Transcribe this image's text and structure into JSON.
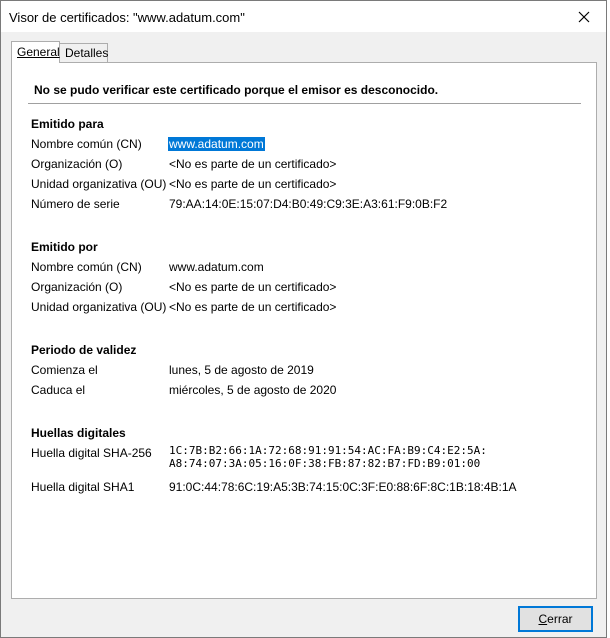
{
  "window": {
    "title": "Visor de certificados: \"www.adatum.com\"",
    "close_icon": "close-icon"
  },
  "tabs": [
    {
      "label": "General",
      "active": true
    },
    {
      "label": "Detalles",
      "active": false
    }
  ],
  "warning": "No se pudo verificar este certificado porque el emisor es desconocido.",
  "issued_to": {
    "title": "Emitido para",
    "rows": [
      {
        "label": "Nombre común (CN)",
        "value": "www.adatum.com"
      },
      {
        "label": "Organización (O)",
        "value": "<No es parte de un certificado>"
      },
      {
        "label": "Unidad organizativa (OU)",
        "value": "<No es parte de un certificado>"
      },
      {
        "label": "Número de serie",
        "value": "79:AA:14:0E:15:07:D4:B0:49:C9:3E:A3:61:F9:0B:F2"
      }
    ]
  },
  "issued_by": {
    "title": "Emitido por",
    "rows": [
      {
        "label": "Nombre común (CN)",
        "value": "www.adatum.com"
      },
      {
        "label": "Organización (O)",
        "value": "<No es parte de un certificado>"
      },
      {
        "label": "Unidad organizativa (OU)",
        "value": "<No es parte de un certificado>"
      }
    ]
  },
  "validity": {
    "title": "Periodo de validez",
    "rows": [
      {
        "label": "Comienza el",
        "value": "lunes, 5 de agosto de 2019"
      },
      {
        "label": "Caduca el",
        "value": "miércoles, 5 de agosto de 2020"
      }
    ]
  },
  "fingerprints": {
    "title": "Huellas digitales",
    "sha256_label": "Huella digital SHA-256",
    "sha256_line1": "1C:7B:B2:66:1A:72:68:91:91:54:AC:FA:B9:C4:E2:5A:",
    "sha256_line2": "A8:74:07:3A:05:16:0F:38:FB:87:82:B7:FD:B9:01:00",
    "sha1_label": "Huella digital SHA1",
    "sha1_value": "91:0C:44:78:6C:19:A5:3B:74:15:0C:3F:E0:88:6F:8C:1B:18:4B:1A"
  },
  "buttons": {
    "close_label_underlined": "C",
    "close_label_rest": "errar"
  },
  "colors": {
    "selection": "#0078d7",
    "dialog_bg": "#f0f0f0"
  }
}
